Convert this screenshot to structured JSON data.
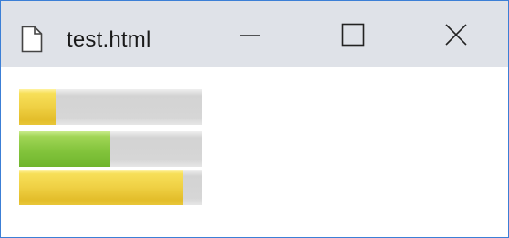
{
  "window": {
    "title": "test.html",
    "icon": "document-icon",
    "controls": {
      "minimize_icon": "minimize-icon",
      "maximize_icon": "maximize-icon",
      "close_icon": "close-icon"
    }
  },
  "progress_bars": [
    {
      "percent": 20,
      "color": "#efd044",
      "style": "yellow"
    },
    {
      "percent": 50,
      "color": "#83c43c",
      "style": "green"
    },
    {
      "percent": 90,
      "color": "#efd044",
      "style": "yellow"
    }
  ],
  "colors": {
    "titlebar": "#dfe2e8",
    "window_border": "#3c7fd6",
    "track": "#d6d6d6"
  }
}
